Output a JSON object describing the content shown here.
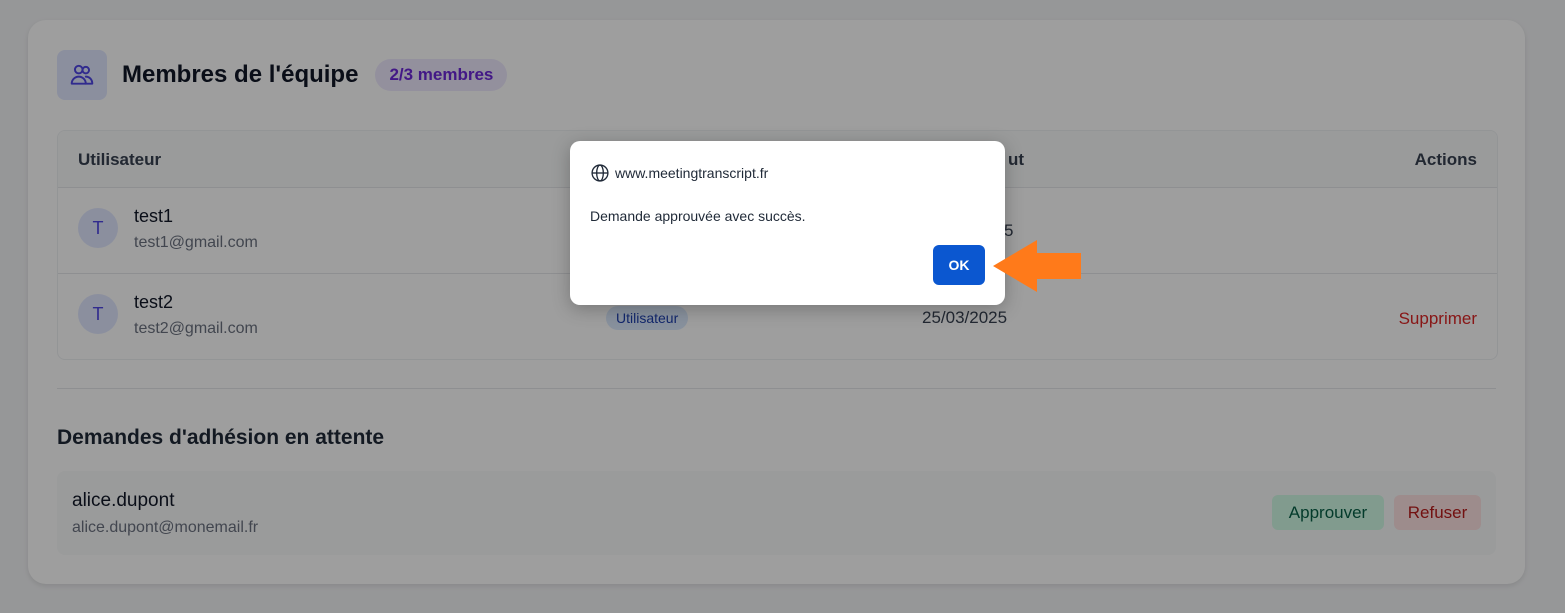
{
  "team": {
    "title": "Membres de l'équipe",
    "member_badge": "2/3 membres",
    "icon": "users-icon"
  },
  "table": {
    "headers": {
      "user": "Utilisateur",
      "status": "ut",
      "actions": "Actions"
    },
    "rows": [
      {
        "initial": "T",
        "name": "test1",
        "email": "test1@gmail.com",
        "date_fragment": "5"
      },
      {
        "initial": "T",
        "name": "test2",
        "email": "test2@gmail.com",
        "role": "Utilisateur",
        "date": "25/03/2025",
        "action": "Supprimer"
      }
    ]
  },
  "pending": {
    "title": "Demandes d'adhésion en attente",
    "requests": [
      {
        "name": "alice.dupont",
        "email": "alice.dupont@monemail.fr",
        "approve_label": "Approuver",
        "refuse_label": "Refuser"
      }
    ]
  },
  "dialog": {
    "origin": "www.meetingtranscript.fr",
    "message": "Demande approuvée avec succès.",
    "ok_label": "OK",
    "icon": "globe-icon"
  },
  "annotation": {
    "icon": "arrow-left-icon",
    "color": "#ff7a1a"
  },
  "colors": {
    "ok_button": "#0b57d0",
    "badge_text": "#6d28d9",
    "delete_text": "#dc2626"
  }
}
